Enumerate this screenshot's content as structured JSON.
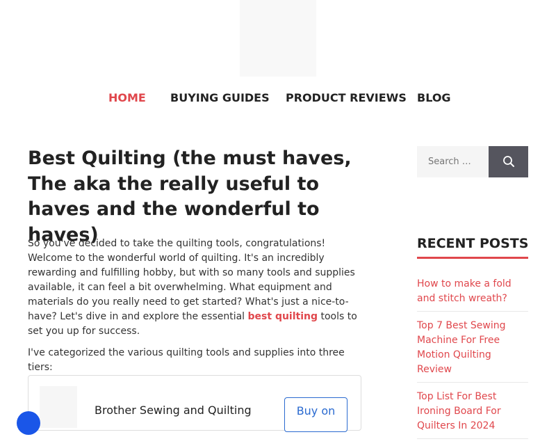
{
  "nav": {
    "items": [
      {
        "label": "HOME",
        "active": true
      },
      {
        "label": "BUYING GUIDES",
        "active": false
      },
      {
        "label": "PRODUCT REVIEWS",
        "active": false
      },
      {
        "label": "BLOG",
        "active": false
      }
    ]
  },
  "article": {
    "title": "Best Quilting (the must haves, The aka the really useful to haves and the wonderful to haves)",
    "intro_text": "So you've decided to take the quilting tools, congratulations! Welcome to the wonderful world of quilting. It's an incredibly rewarding and fulfilling hobby, but with so many tools and supplies available, it can feel a bit overwhelming. What equipment and materials do you really need to get started? What's just a nice-to-have? Let's dive in and explore the essential",
    "intro_link": "best quilting",
    "intro_tail": "tools to set you up for success.",
    "tiers_text": "I've categorized the various quilting tools and supplies into three tiers:",
    "product": {
      "name": "Brother Sewing and Quilting",
      "button_label": "Buy on"
    }
  },
  "sidebar": {
    "search": {
      "placeholder": "Search …",
      "button_icon": "search-icon"
    },
    "recent_posts": {
      "title": "RECENT POSTS",
      "items": [
        "How to make a fold and stitch wreath?",
        "Top 7 Best Sewing Machine For Free Motion Quilting Review",
        "Top List For Best Ironing Board For Quilters In 2024"
      ]
    }
  },
  "colors": {
    "accent": "#e0474c",
    "text": "#222222",
    "search_button": "#55555e",
    "buy_button": "#2a6ad0",
    "floating_button": "#1a56e8"
  }
}
